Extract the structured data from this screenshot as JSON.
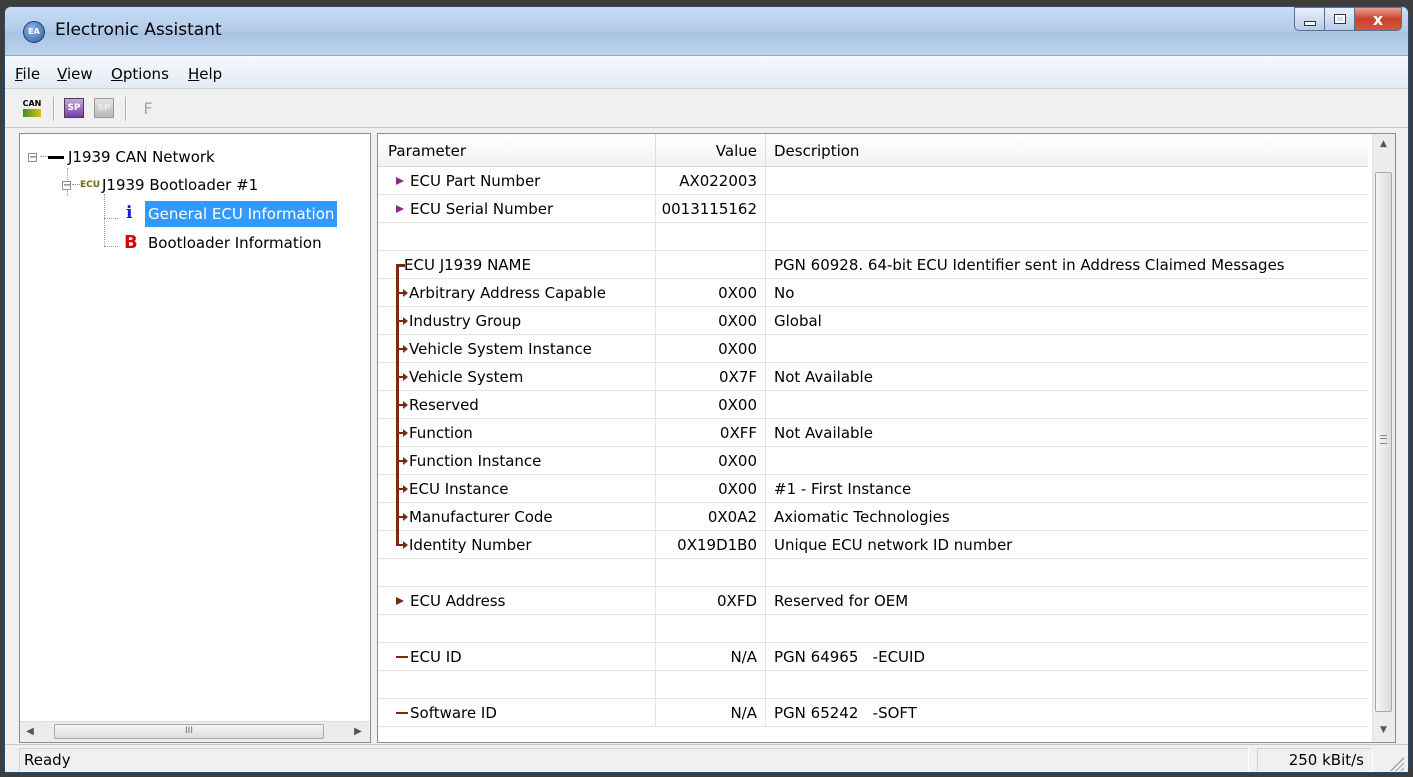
{
  "window": {
    "title": "Electronic Assistant",
    "close_glyph": "x"
  },
  "menu": {
    "file": {
      "mnemonic": "F",
      "rest": "ile"
    },
    "view": {
      "mnemonic": "V",
      "rest": "iew"
    },
    "options": {
      "mnemonic": "O",
      "rest": "ptions"
    },
    "help": {
      "mnemonic": "H",
      "rest": "elp"
    }
  },
  "toolbar": {
    "can_icon_text": "CAN",
    "sp_icon_text": "SP",
    "sp_disabled_icon_text": "SP",
    "f_icon_text": "F"
  },
  "tree": {
    "network": {
      "label": "J1939 CAN Network",
      "expanded": true
    },
    "bootloader": {
      "tag": "ECU",
      "label": "J1939 Bootloader #1",
      "expanded": true
    },
    "general": {
      "icon_text": "i",
      "label": "General ECU Information",
      "selected": true
    },
    "bootinfo": {
      "icon_text": "B",
      "label": "Bootloader Information"
    },
    "hscroll_grip": "III"
  },
  "grid": {
    "headers": {
      "parameter": "Parameter",
      "value": "Value",
      "description": "Description"
    },
    "rows": [
      {
        "parameter": "ECU Part Number",
        "value": "AX022003",
        "description": "",
        "icon": "bullet"
      },
      {
        "parameter": "ECU Serial Number",
        "value": "0013115162",
        "description": "",
        "icon": "bullet"
      },
      {
        "parameter": "",
        "value": "",
        "description": "",
        "icon": "none"
      },
      {
        "parameter": "ECU J1939 NAME",
        "value": "",
        "description": "PGN 60928. 64-bit ECU Identifier sent in Address Claimed Messages",
        "icon": "bracket"
      },
      {
        "parameter": "Arbitrary Address Capable",
        "value": "0X00",
        "description": "No",
        "icon": "branch"
      },
      {
        "parameter": "Industry Group",
        "value": "0X00",
        "description": "Global",
        "icon": "branch"
      },
      {
        "parameter": "Vehicle System Instance",
        "value": "0X00",
        "description": "",
        "icon": "branch"
      },
      {
        "parameter": "Vehicle System",
        "value": "0X7F",
        "description": "Not Available",
        "icon": "branch"
      },
      {
        "parameter": "Reserved",
        "value": "0X00",
        "description": "",
        "icon": "branch"
      },
      {
        "parameter": "Function",
        "value": "0XFF",
        "description": "Not Available",
        "icon": "branch"
      },
      {
        "parameter": "Function Instance",
        "value": "0X00",
        "description": "",
        "icon": "branch"
      },
      {
        "parameter": "ECU Instance",
        "value": "0X00",
        "description": "#1 - First Instance",
        "icon": "branch"
      },
      {
        "parameter": "Manufacturer Code",
        "value": "0X0A2",
        "description": "Axiomatic Technologies",
        "icon": "branch"
      },
      {
        "parameter": "Identity Number",
        "value": "0X19D1B0",
        "description": "Unique ECU network ID number",
        "icon": "branch-last"
      },
      {
        "parameter": "",
        "value": "",
        "description": "",
        "icon": "none"
      },
      {
        "parameter": "ECU Address",
        "value": "0XFD",
        "description": "Reserved for OEM",
        "icon": "bullet-dark"
      },
      {
        "parameter": "",
        "value": "",
        "description": "",
        "icon": "none"
      },
      {
        "parameter": "ECU ID",
        "value": "N/A",
        "description": "PGN 64965   -ECUID",
        "icon": "dash"
      },
      {
        "parameter": "",
        "value": "",
        "description": "",
        "icon": "none"
      },
      {
        "parameter": "Software ID",
        "value": "N/A",
        "description": "PGN 65242   -SOFT",
        "icon": "dash"
      }
    ]
  },
  "status": {
    "text": "Ready",
    "bitrate": "250 kBit/s"
  }
}
